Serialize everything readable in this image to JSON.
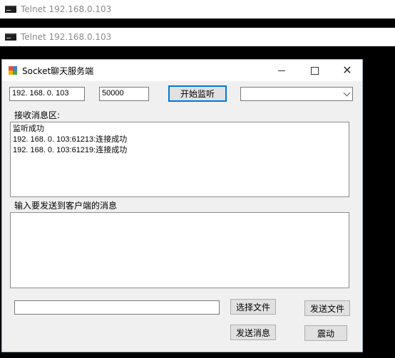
{
  "telnet": [
    {
      "title": "Telnet 192.168.0.103"
    },
    {
      "title": "Telnet 192.168.0.103"
    }
  ],
  "window": {
    "title": "Socket聊天服务端",
    "ip_value": "192. 168. 0. 103",
    "port_value": "50000",
    "listen_button": "开始监听",
    "client_select_value": "",
    "receive_label": "接收消息区:",
    "receive_lines": [
      "监听成功",
      "192. 168. 0. 103:61213:连接成功",
      "192. 168. 0. 103:61219:连接成功"
    ],
    "send_label": "输入要发送到客户端的消息",
    "send_message_value": "",
    "file_path_value": "",
    "choose_file_button": "选择文件",
    "send_file_button": "发送文件",
    "send_message_button": "发送消息",
    "shake_button": "震动"
  }
}
